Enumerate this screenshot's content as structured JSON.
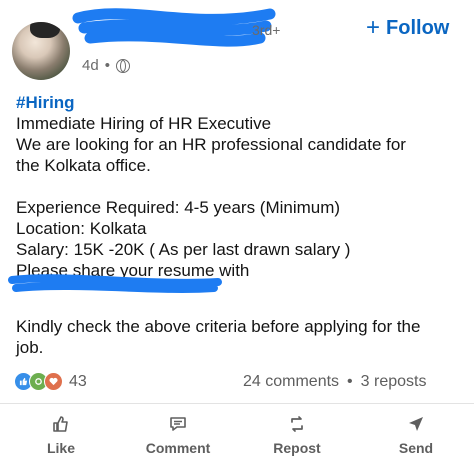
{
  "header": {
    "degree": "3rd+",
    "follow_label": "Follow",
    "time_ago": "4d",
    "separator": "•"
  },
  "post": {
    "hashtag": "#Hiring",
    "lines": [
      "Immediate Hiring of HR Executive",
      "We are looking for an HR professional candidate for",
      "the Kolkata office.",
      "Experience Required: 4-5 years (Minimum)",
      "Location: Kolkata",
      "Salary: 15K -20K ( As per last drawn salary )",
      "Please share your resume with"
    ],
    "closing": [
      "Kindly check the above criteria before applying for the",
      "job."
    ]
  },
  "social": {
    "reaction_count": "43",
    "comments": "24 comments",
    "dot": "•",
    "reposts": "3 reposts",
    "reaction_icons": [
      "like-icon",
      "support-icon",
      "love-icon"
    ]
  },
  "actions": {
    "like": "Like",
    "comment": "Comment",
    "repost": "Repost",
    "send": "Send"
  },
  "colors": {
    "accent": "#0a66c2",
    "redaction": "#1e7cf2"
  }
}
